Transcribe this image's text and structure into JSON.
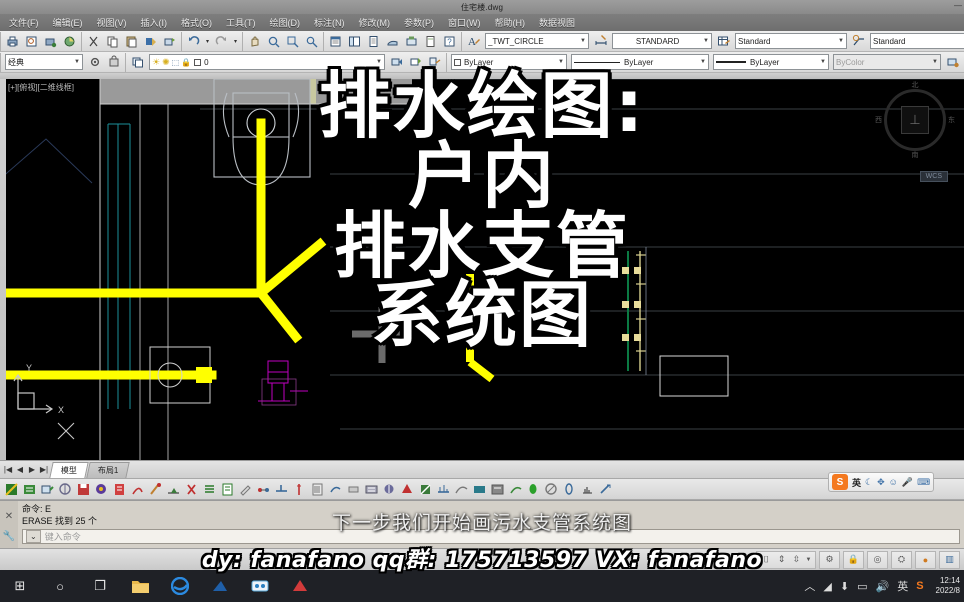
{
  "window": {
    "document_title": "住宅楼.dwg",
    "minimize": "—",
    "restore": "▫",
    "close": "✕"
  },
  "menubar": {
    "items": [
      {
        "label": "文件(F)"
      },
      {
        "label": "编辑(E)"
      },
      {
        "label": "视图(V)"
      },
      {
        "label": "插入(I)"
      },
      {
        "label": "格式(O)"
      },
      {
        "label": "工具(T)"
      },
      {
        "label": "绘图(D)"
      },
      {
        "label": "标注(N)"
      },
      {
        "label": "修改(M)"
      },
      {
        "label": "参数(P)"
      },
      {
        "label": "窗口(W)"
      },
      {
        "label": "帮助(H)"
      },
      {
        "label": "数据视图"
      }
    ]
  },
  "toolbar_row1": {
    "style_combo": "_TWT_CIRCLE",
    "text_style_combo": "STANDARD",
    "dim_style_combo": "Standard",
    "table_style_combo": "Standard"
  },
  "toolbar_row2": {
    "workspace_combo": "经典",
    "layer_combo": "0",
    "color_combo": "ByLayer",
    "linetype_combo": "ByLayer",
    "lineweight_combo": "ByLayer",
    "plotstyle_combo": "ByColor"
  },
  "canvas": {
    "viewport_label": "[+][俯视][二维线框]",
    "compass": {
      "north": "北",
      "south": "南",
      "west": "西",
      "east": "东",
      "ucs_badge": "WCS"
    },
    "ucs_axis_x": "X",
    "ucs_axis_y": "Y"
  },
  "layout_tabs": {
    "nav_first": "|◀",
    "nav_prev": "◀",
    "nav_next": "▶",
    "nav_last": "▶|",
    "tabs": [
      {
        "label": "模型",
        "active": true
      },
      {
        "label": "布局1",
        "active": false
      }
    ]
  },
  "command_window": {
    "history": [
      "命令: E",
      "ERASE 找到 25 个"
    ],
    "prompt_symbol": "⌄",
    "input_value": "",
    "input_placeholder": "键入命令"
  },
  "status_bar": {
    "items": [
      "annotation-scale-icon",
      "annotation-visibility-icon",
      "annotation-auto-icon",
      "workspace-switch-icon",
      "toolbar-lock-icon",
      "isolate-objects-icon",
      "hardware-accel-icon",
      "clean-screen-icon"
    ]
  },
  "ime_bar": {
    "logo": "S",
    "mode": "英",
    "items": [
      "moon-icon",
      "tools-icon",
      "emoji-icon",
      "voice-icon",
      "keyboard-icon"
    ]
  },
  "taskbar": {
    "items": [
      {
        "name": "start-button",
        "glyph": "⊞"
      },
      {
        "name": "search-button",
        "glyph": "○"
      },
      {
        "name": "task-view-button",
        "glyph": "❐"
      },
      {
        "name": "file-explorer-button",
        "glyph": "🗀"
      },
      {
        "name": "edge-browser-button",
        "glyph": "e"
      },
      {
        "name": "app-blue-button",
        "glyph": "◣"
      },
      {
        "name": "app-cyan-button",
        "glyph": "▦"
      },
      {
        "name": "app-red-button",
        "glyph": "▲"
      }
    ],
    "tray": {
      "show_hidden": "︿",
      "network": "◣",
      "onedrive": "⇩",
      "battery": "▭",
      "volume": "◁»",
      "ime_mode": "英",
      "sogou": "S",
      "time": "12:14",
      "date": "2022/8"
    }
  },
  "overlay": {
    "title_lines": [
      "排水绘图:",
      "户内",
      "排水支管",
      "系统图"
    ],
    "subtitle": "下一步我们开始画污水支管系统图",
    "watermark": "dy: fanafano  qq群: 175713597  VX: fanafano"
  },
  "colors": {
    "pipe_yellow": "#FFFF00",
    "canvas_black": "#000000",
    "riser_green": "#0b7a43",
    "fixture_gray": "#9aa0a6",
    "accent_magenta": "#c000c0",
    "taskbar": "#1f2126"
  }
}
